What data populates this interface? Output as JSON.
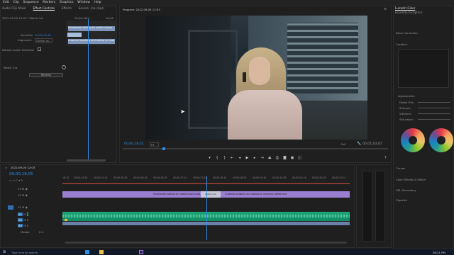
{
  "menu": [
    "Edit",
    "Clip",
    "Sequence",
    "Markers",
    "Graphics",
    "Window",
    "Help"
  ],
  "effects_panel": {
    "tabs": [
      "Audio Clip Mixer",
      "Effect Controls",
      "Effects",
      "Source: (no clips)"
    ],
    "breadcrumb": "2022-09-05 12:03 * Match Cut",
    "timecode_top": "00;00;16;0",
    "timecode_top_right": "00;05",
    "clip_label_1": "Emotionally talking by mobile phone",
    "clip_label_2": "A woman smoking and talking on mob",
    "duration_label": "Direction",
    "duration_value": "00;00;00;15",
    "alignment_label": "Alignment",
    "alignment_value": "Center at...",
    "default_audio": "Default Audio Transition",
    "match_cut_label": "Match Cut",
    "reverse_btn": "Reverse"
  },
  "program": {
    "title": "Program: 2022-09-05 12:03",
    "menu_icon": "hamburger-icon",
    "timecode": "00;00;18;05",
    "fit": "Fit",
    "quality": "Full",
    "duration": "00;01;03;07"
  },
  "timeline": {
    "title": "2022-09-05 12:03",
    "timecode": "00;00;18;05",
    "ruler": [
      "16;14",
      "00;00;14;29",
      "00;00;15;14",
      "00;00;15;29",
      "00;00;16;14",
      "00;00;16;29",
      "00;00;17;14",
      "00;00;17;29",
      "00;00;18;14",
      "00;00;18;29",
      "00;00;19;14",
      "00;00;19;29",
      "00;00;20;14",
      "00;00;20;29",
      "00;00;21;14"
    ],
    "tracks": [
      "V3",
      "V2",
      "V1",
      "A1",
      "A2",
      "A3"
    ],
    "master": "Master",
    "master_value": "0.0",
    "clip_v1_left": "Emotionally talking by mobile phone.mp4",
    "clip_v1_right": "A woman smoking and talking on romantic coffee.mp4",
    "transition": "Match Cut"
  },
  "lumetri": {
    "tabs": [
      "Lumetri Color",
      "Essential Graphics"
    ],
    "sections": [
      "Basic Correction",
      "Creative",
      "Adjustments",
      "Curves",
      "Color Wheels & Match",
      "HSL Secondary",
      "Vignette"
    ],
    "adjust_labels": [
      "Faded Film",
      "Sharpen",
      "Vibrance",
      "Saturation"
    ]
  },
  "taskbar": {
    "search": "Type here to search",
    "clock": "08:21 PM"
  }
}
